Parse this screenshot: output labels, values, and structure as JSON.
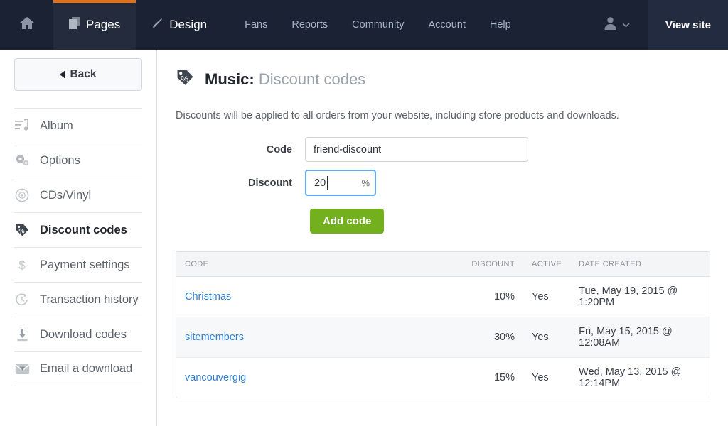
{
  "topnav": {
    "home_icon": "home-icon",
    "tabs": [
      {
        "label": "Pages",
        "icon": "pages-icon",
        "active": true
      },
      {
        "label": "Design",
        "icon": "pencil-icon",
        "active": false
      }
    ],
    "links": [
      "Fans",
      "Reports",
      "Community",
      "Account",
      "Help"
    ],
    "user_icon": "user-avatar-icon",
    "chevron_icon": "chevron-down-icon",
    "view_site": "View site",
    "accent_color": "#e0711d",
    "background_color": "#1b2233"
  },
  "sidebar": {
    "back_label": "Back",
    "items": [
      {
        "label": "Album",
        "icon": "music-list-icon",
        "active": false
      },
      {
        "label": "Options",
        "icon": "gears-icon",
        "active": false
      },
      {
        "label": "CDs/Vinyl",
        "icon": "disc-icon",
        "active": false
      },
      {
        "label": "Discount codes",
        "icon": "tag-percent-icon",
        "active": true
      },
      {
        "label": "Payment settings",
        "icon": "dollar-icon",
        "active": false
      },
      {
        "label": "Transaction history",
        "icon": "clock-arrow-icon",
        "active": false
      },
      {
        "label": "Download codes",
        "icon": "download-icon",
        "active": false
      },
      {
        "label": "Email a download",
        "icon": "envelope-download-icon",
        "active": false
      }
    ]
  },
  "main": {
    "badge_icon": "tag-percent-icon",
    "title_prefix": "Music:",
    "title_suffix": "Discount codes",
    "lead": "Discounts will be applied to all orders from your website, including store products and downloads.",
    "form": {
      "code_label": "Code",
      "code_value": "friend-discount",
      "code_placeholder": "",
      "discount_label": "Discount",
      "discount_value": "20",
      "discount_suffix": "%",
      "submit_label": "Add code",
      "submit_color": "#72b01d",
      "focused_field": "discount"
    },
    "table": {
      "columns": [
        "CODE",
        "DISCOUNT",
        "ACTIVE",
        "DATE CREATED"
      ],
      "rows": [
        {
          "code": "Christmas",
          "discount": "10%",
          "active": "Yes",
          "date": "Tue, May 19, 2015 @ 1:20PM"
        },
        {
          "code": "sitemembers",
          "discount": "30%",
          "active": "Yes",
          "date": "Fri, May 15, 2015 @ 12:08AM"
        },
        {
          "code": "vancouvergig",
          "discount": "15%",
          "active": "Yes",
          "date": "Wed, May 13, 2015 @ 12:14PM"
        }
      ]
    }
  }
}
